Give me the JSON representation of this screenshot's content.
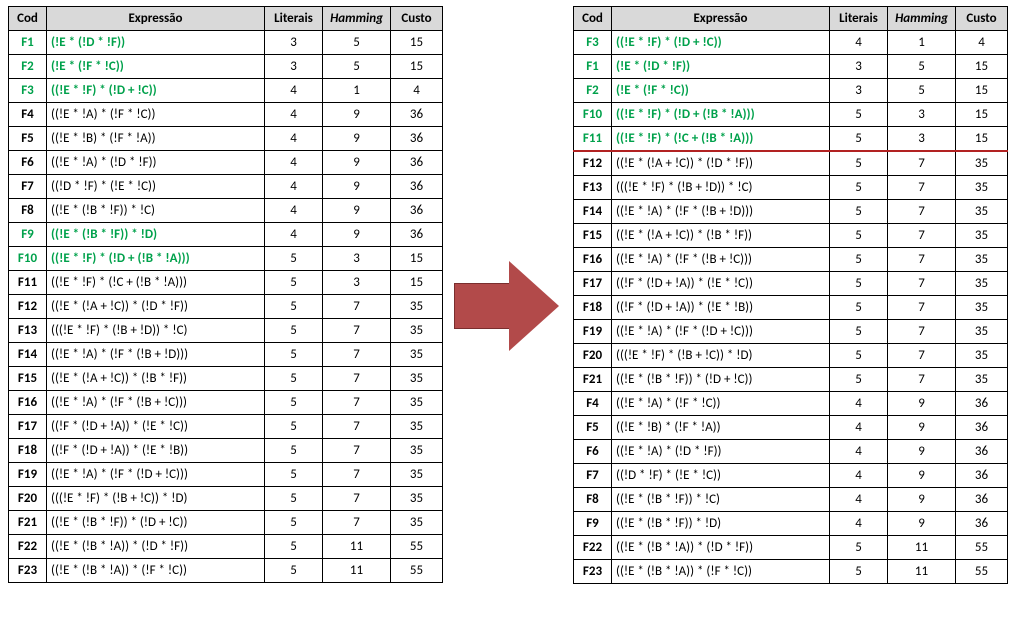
{
  "headers": {
    "cod": "Cod",
    "expr": "Expressão",
    "lit": "Literais",
    "ham": "Hamming",
    "cst": "Custo"
  },
  "left_highlight_cods": [
    "F1",
    "F2",
    "F3",
    "F9",
    "F10"
  ],
  "right_highlight_cods": [
    "F3",
    "F1",
    "F2",
    "F10",
    "F11"
  ],
  "right_sep_after_cod": "F11",
  "left": [
    {
      "cod": "F1",
      "expr": "(!E * (!D * !F))",
      "lit": 3,
      "ham": 5,
      "cst": 15
    },
    {
      "cod": "F2",
      "expr": "(!E * (!F * !C))",
      "lit": 3,
      "ham": 5,
      "cst": 15
    },
    {
      "cod": "F3",
      "expr": "((!E * !F) * (!D + !C))",
      "lit": 4,
      "ham": 1,
      "cst": 4
    },
    {
      "cod": "F4",
      "expr": "((!E * !A) * (!F * !C))",
      "lit": 4,
      "ham": 9,
      "cst": 36
    },
    {
      "cod": "F5",
      "expr": "((!E * !B) * (!F * !A))",
      "lit": 4,
      "ham": 9,
      "cst": 36
    },
    {
      "cod": "F6",
      "expr": "((!E * !A) * (!D * !F))",
      "lit": 4,
      "ham": 9,
      "cst": 36
    },
    {
      "cod": "F7",
      "expr": "((!D * !F) * (!E * !C))",
      "lit": 4,
      "ham": 9,
      "cst": 36
    },
    {
      "cod": "F8",
      "expr": "((!E * (!B * !F)) * !C)",
      "lit": 4,
      "ham": 9,
      "cst": 36
    },
    {
      "cod": "F9",
      "expr": "((!E * (!B * !F)) * !D)",
      "lit": 4,
      "ham": 9,
      "cst": 36
    },
    {
      "cod": "F10",
      "expr": "((!E * !F) * (!D + (!B * !A)))",
      "lit": 5,
      "ham": 3,
      "cst": 15
    },
    {
      "cod": "F11",
      "expr": "((!E * !F) * (!C + (!B * !A)))",
      "lit": 5,
      "ham": 3,
      "cst": 15
    },
    {
      "cod": "F12",
      "expr": "((!E * (!A + !C)) * (!D * !F))",
      "lit": 5,
      "ham": 7,
      "cst": 35
    },
    {
      "cod": "F13",
      "expr": "(((!E * !F) * (!B + !D)) * !C)",
      "lit": 5,
      "ham": 7,
      "cst": 35
    },
    {
      "cod": "F14",
      "expr": "((!E * !A) * (!F * (!B + !D)))",
      "lit": 5,
      "ham": 7,
      "cst": 35
    },
    {
      "cod": "F15",
      "expr": "((!E * (!A + !C)) * (!B * !F))",
      "lit": 5,
      "ham": 7,
      "cst": 35
    },
    {
      "cod": "F16",
      "expr": "((!E * !A) * (!F * (!B + !C)))",
      "lit": 5,
      "ham": 7,
      "cst": 35
    },
    {
      "cod": "F17",
      "expr": "((!F * (!D + !A)) * (!E * !C))",
      "lit": 5,
      "ham": 7,
      "cst": 35
    },
    {
      "cod": "F18",
      "expr": "((!F * (!D + !A)) * (!E * !B))",
      "lit": 5,
      "ham": 7,
      "cst": 35
    },
    {
      "cod": "F19",
      "expr": "((!E * !A) * (!F * (!D + !C)))",
      "lit": 5,
      "ham": 7,
      "cst": 35
    },
    {
      "cod": "F20",
      "expr": "(((!E * !F) * (!B + !C)) * !D)",
      "lit": 5,
      "ham": 7,
      "cst": 35
    },
    {
      "cod": "F21",
      "expr": "((!E * (!B * !F)) * (!D + !C))",
      "lit": 5,
      "ham": 7,
      "cst": 35
    },
    {
      "cod": "F22",
      "expr": "((!E * (!B * !A)) * (!D * !F))",
      "lit": 5,
      "ham": 11,
      "cst": 55
    },
    {
      "cod": "F23",
      "expr": "((!E * (!B * !A)) * (!F * !C))",
      "lit": 5,
      "ham": 11,
      "cst": 55
    }
  ],
  "right": [
    {
      "cod": "F3",
      "expr": "((!E * !F) * (!D + !C))",
      "lit": 4,
      "ham": 1,
      "cst": 4
    },
    {
      "cod": "F1",
      "expr": "(!E * (!D * !F))",
      "lit": 3,
      "ham": 5,
      "cst": 15
    },
    {
      "cod": "F2",
      "expr": "(!E * (!F * !C))",
      "lit": 3,
      "ham": 5,
      "cst": 15
    },
    {
      "cod": "F10",
      "expr": "((!E * !F) * (!D + (!B * !A)))",
      "lit": 5,
      "ham": 3,
      "cst": 15
    },
    {
      "cod": "F11",
      "expr": "((!E * !F) * (!C + (!B * !A)))",
      "lit": 5,
      "ham": 3,
      "cst": 15
    },
    {
      "cod": "F12",
      "expr": "((!E * (!A + !C)) * (!D * !F))",
      "lit": 5,
      "ham": 7,
      "cst": 35
    },
    {
      "cod": "F13",
      "expr": "(((!E * !F) * (!B + !D)) * !C)",
      "lit": 5,
      "ham": 7,
      "cst": 35
    },
    {
      "cod": "F14",
      "expr": "((!E * !A) * (!F * (!B + !D)))",
      "lit": 5,
      "ham": 7,
      "cst": 35
    },
    {
      "cod": "F15",
      "expr": "((!E * (!A + !C)) * (!B * !F))",
      "lit": 5,
      "ham": 7,
      "cst": 35
    },
    {
      "cod": "F16",
      "expr": "((!E * !A) * (!F * (!B + !C)))",
      "lit": 5,
      "ham": 7,
      "cst": 35
    },
    {
      "cod": "F17",
      "expr": "((!F * (!D + !A)) * (!E * !C))",
      "lit": 5,
      "ham": 7,
      "cst": 35
    },
    {
      "cod": "F18",
      "expr": "((!F * (!D + !A)) * (!E * !B))",
      "lit": 5,
      "ham": 7,
      "cst": 35
    },
    {
      "cod": "F19",
      "expr": "((!E * !A) * (!F * (!D + !C)))",
      "lit": 5,
      "ham": 7,
      "cst": 35
    },
    {
      "cod": "F20",
      "expr": "(((!E * !F) * (!B + !C)) * !D)",
      "lit": 5,
      "ham": 7,
      "cst": 35
    },
    {
      "cod": "F21",
      "expr": "((!E * (!B * !F)) * (!D + !C))",
      "lit": 5,
      "ham": 7,
      "cst": 35
    },
    {
      "cod": "F4",
      "expr": "((!E * !A) * (!F * !C))",
      "lit": 4,
      "ham": 9,
      "cst": 36
    },
    {
      "cod": "F5",
      "expr": "((!E * !B) * (!F * !A))",
      "lit": 4,
      "ham": 9,
      "cst": 36
    },
    {
      "cod": "F6",
      "expr": "((!E * !A) * (!D * !F))",
      "lit": 4,
      "ham": 9,
      "cst": 36
    },
    {
      "cod": "F7",
      "expr": "((!D * !F) * (!E * !C))",
      "lit": 4,
      "ham": 9,
      "cst": 36
    },
    {
      "cod": "F8",
      "expr": "((!E * (!B * !F)) * !C)",
      "lit": 4,
      "ham": 9,
      "cst": 36
    },
    {
      "cod": "F9",
      "expr": "((!E * (!B * !F)) * !D)",
      "lit": 4,
      "ham": 9,
      "cst": 36
    },
    {
      "cod": "F22",
      "expr": "((!E * (!B * !A)) * (!D * !F))",
      "lit": 5,
      "ham": 11,
      "cst": 55
    },
    {
      "cod": "F23",
      "expr": "((!E * (!B * !A)) * (!F * !C))",
      "lit": 5,
      "ham": 11,
      "cst": 55
    }
  ]
}
